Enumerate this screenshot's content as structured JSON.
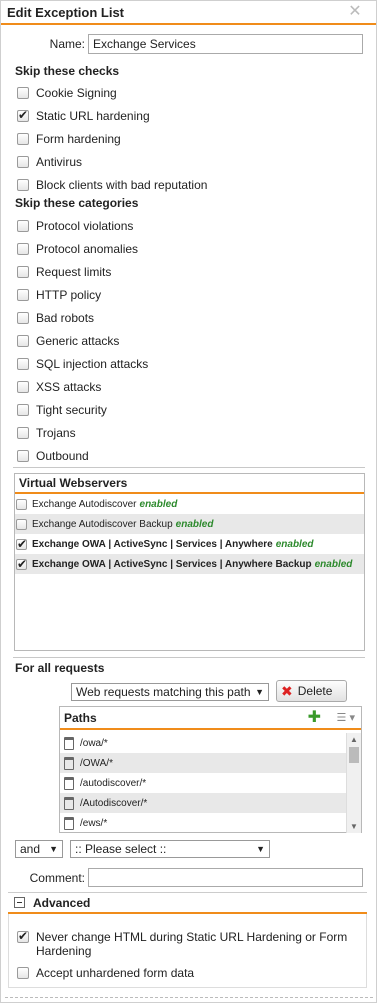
{
  "dialog": {
    "title": "Edit Exception List"
  },
  "name": {
    "label": "Name:",
    "value": "Exchange Services"
  },
  "skip_checks": {
    "heading": "Skip these checks",
    "items": [
      {
        "label": "Cookie Signing",
        "checked": false
      },
      {
        "label": "Static URL hardening",
        "checked": true
      },
      {
        "label": "Form hardening",
        "checked": false
      },
      {
        "label": "Antivirus",
        "checked": false
      },
      {
        "label": "Block clients with bad reputation",
        "checked": false
      }
    ]
  },
  "skip_categories": {
    "heading": "Skip these categories",
    "items": [
      {
        "label": "Protocol violations",
        "checked": false
      },
      {
        "label": "Protocol anomalies",
        "checked": false
      },
      {
        "label": "Request limits",
        "checked": false
      },
      {
        "label": "HTTP policy",
        "checked": false
      },
      {
        "label": "Bad robots",
        "checked": false
      },
      {
        "label": "Generic attacks",
        "checked": false
      },
      {
        "label": "SQL injection attacks",
        "checked": false
      },
      {
        "label": "XSS attacks",
        "checked": false
      },
      {
        "label": "Tight security",
        "checked": false
      },
      {
        "label": "Trojans",
        "checked": false
      },
      {
        "label": "Outbound",
        "checked": false
      }
    ]
  },
  "virtual_webservers": {
    "heading": "Virtual Webservers",
    "items": [
      {
        "name": "Exchange Autodiscover",
        "status": "enabled",
        "checked": false
      },
      {
        "name": "Exchange Autodiscover Backup",
        "status": "enabled",
        "checked": false
      },
      {
        "name": "Exchange OWA | ActiveSync | Services | Anywhere",
        "status": "enabled",
        "checked": true
      },
      {
        "name": "Exchange OWA | ActiveSync | Services | Anywhere Backup",
        "status": "enabled",
        "checked": true
      }
    ]
  },
  "requests": {
    "heading": "For all requests",
    "match_select": "Web requests matching this path",
    "delete_label": "Delete",
    "paths_heading": "Paths",
    "paths": [
      "/owa/*",
      "/OWA/*",
      "/autodiscover/*",
      "/Autodiscover/*",
      "/ews/*"
    ],
    "and_select": "and",
    "please_select": ":: Please select ::"
  },
  "comment": {
    "label": "Comment:",
    "value": ""
  },
  "advanced": {
    "heading": "Advanced",
    "items": [
      {
        "label": "Never change HTML during Static URL Hardening or Form Hardening",
        "checked": true
      },
      {
        "label": "Accept unhardened form data",
        "checked": false
      }
    ]
  },
  "colors": {
    "accent": "#f08c1a",
    "enabled": "#2d8a2d",
    "delete_x": "#dd2222",
    "add_plus": "#3a9a2a"
  }
}
